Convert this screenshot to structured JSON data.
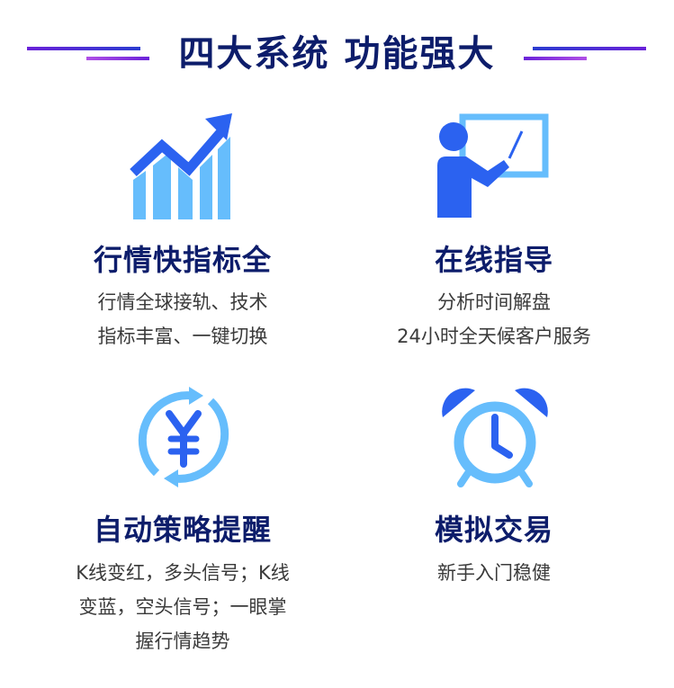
{
  "header": {
    "title": "四大系统 功能强大"
  },
  "colors": {
    "navy": "#0d1d6b",
    "blue": "#2b62f0",
    "light_blue": "#66bdfc",
    "purple": "#6a22d9"
  },
  "features": [
    {
      "title": "行情快指标全",
      "lines": [
        "行情全球接轨、技术",
        "指标丰富、一键切换"
      ],
      "icon": "rising-chart-icon"
    },
    {
      "title": "在线指导",
      "lines": [
        "分析时间解盘",
        "24小时全天候客户服务"
      ],
      "icon": "teacher-board-icon"
    },
    {
      "title": "自动策略提醒",
      "lines": [
        "K线变红，多头信号；K线",
        "变蓝，空头信号；一眼掌",
        "握行情趋势"
      ],
      "icon": "yuan-cycle-icon"
    },
    {
      "title": "模拟交易",
      "lines": [
        "新手入门稳健"
      ],
      "icon": "alarm-clock-icon"
    }
  ]
}
